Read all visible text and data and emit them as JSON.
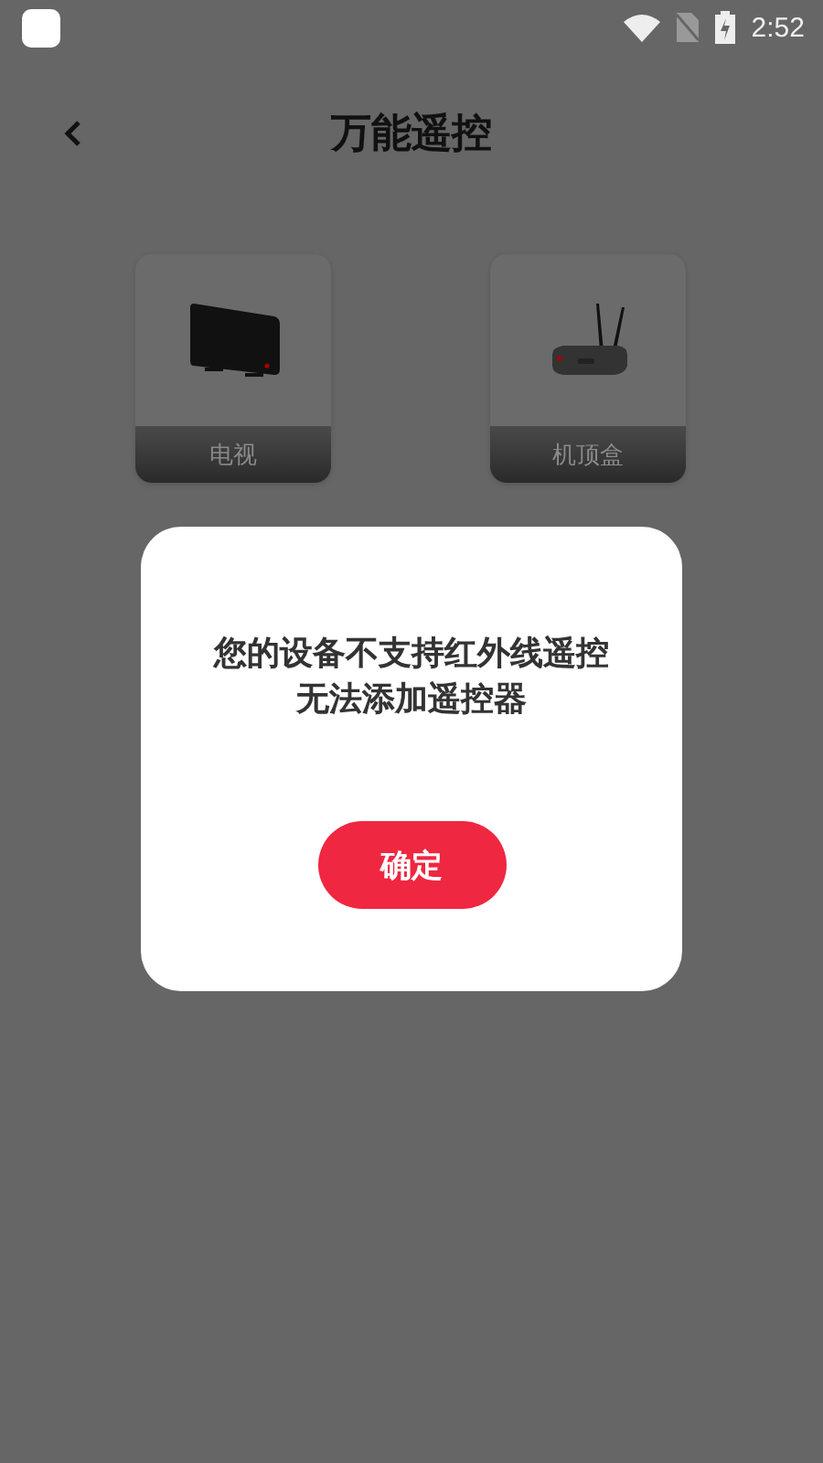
{
  "status_bar": {
    "time": "2:52"
  },
  "header": {
    "title": "万能遥控"
  },
  "devices": [
    {
      "kind": "tv",
      "label": "电视"
    },
    {
      "kind": "settop",
      "label": "机顶盒"
    }
  ],
  "dialog": {
    "lines": [
      "您的设备不支持红外线遥控",
      "无法添加遥控器"
    ],
    "button": "确定"
  }
}
